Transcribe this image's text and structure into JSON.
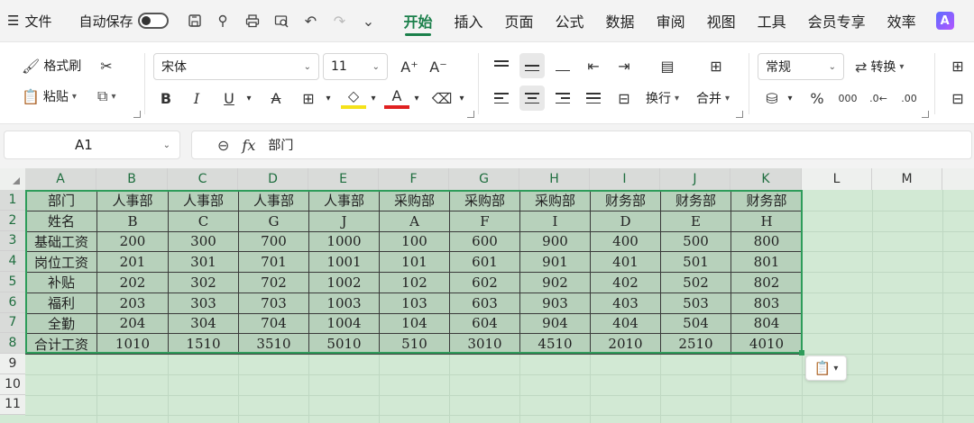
{
  "menubar": {
    "file_label": "文件",
    "autosave_label": "自动保存",
    "tabs": [
      "开始",
      "插入",
      "页面",
      "公式",
      "数据",
      "审阅",
      "视图",
      "工具",
      "会员专享",
      "效率"
    ],
    "active_tab": "开始"
  },
  "ribbon": {
    "format_painter": "格式刷",
    "paste": "粘贴",
    "font_name": "宋体",
    "font_size": "11",
    "wrap_text": "换行",
    "merge": "合并",
    "number_format": "常规",
    "convert": "转换"
  },
  "formula_bar": {
    "cell_ref": "A1",
    "formula": "部门"
  },
  "columns": [
    "A",
    "B",
    "C",
    "D",
    "E",
    "F",
    "G",
    "H",
    "I",
    "J",
    "K",
    "L",
    "M"
  ],
  "rows": [
    "1",
    "2",
    "3",
    "4",
    "5",
    "6",
    "7",
    "8",
    "9",
    "10",
    "11"
  ],
  "table": [
    [
      "部门",
      "人事部",
      "人事部",
      "人事部",
      "人事部",
      "采购部",
      "采购部",
      "采购部",
      "财务部",
      "财务部",
      "财务部"
    ],
    [
      "姓名",
      "B",
      "C",
      "G",
      "J",
      "A",
      "F",
      "I",
      "D",
      "E",
      "H"
    ],
    [
      "基础工资",
      "200",
      "300",
      "700",
      "1000",
      "100",
      "600",
      "900",
      "400",
      "500",
      "800"
    ],
    [
      "岗位工资",
      "201",
      "301",
      "701",
      "1001",
      "101",
      "601",
      "901",
      "401",
      "501",
      "801"
    ],
    [
      "补贴",
      "202",
      "302",
      "702",
      "1002",
      "102",
      "602",
      "902",
      "402",
      "502",
      "802"
    ],
    [
      "福利",
      "203",
      "303",
      "703",
      "1003",
      "103",
      "603",
      "903",
      "403",
      "503",
      "803"
    ],
    [
      "全勤",
      "204",
      "304",
      "704",
      "1004",
      "104",
      "604",
      "904",
      "404",
      "504",
      "804"
    ],
    [
      "合计工资",
      "1010",
      "1510",
      "3510",
      "5010",
      "510",
      "3010",
      "4510",
      "2010",
      "2510",
      "4010"
    ]
  ],
  "colors": {
    "accent": "#1a7f4a",
    "selection_border": "#2e9c5a",
    "cell_fill": "#b7d1bb",
    "sheet_fill": "#d2e9d4"
  }
}
